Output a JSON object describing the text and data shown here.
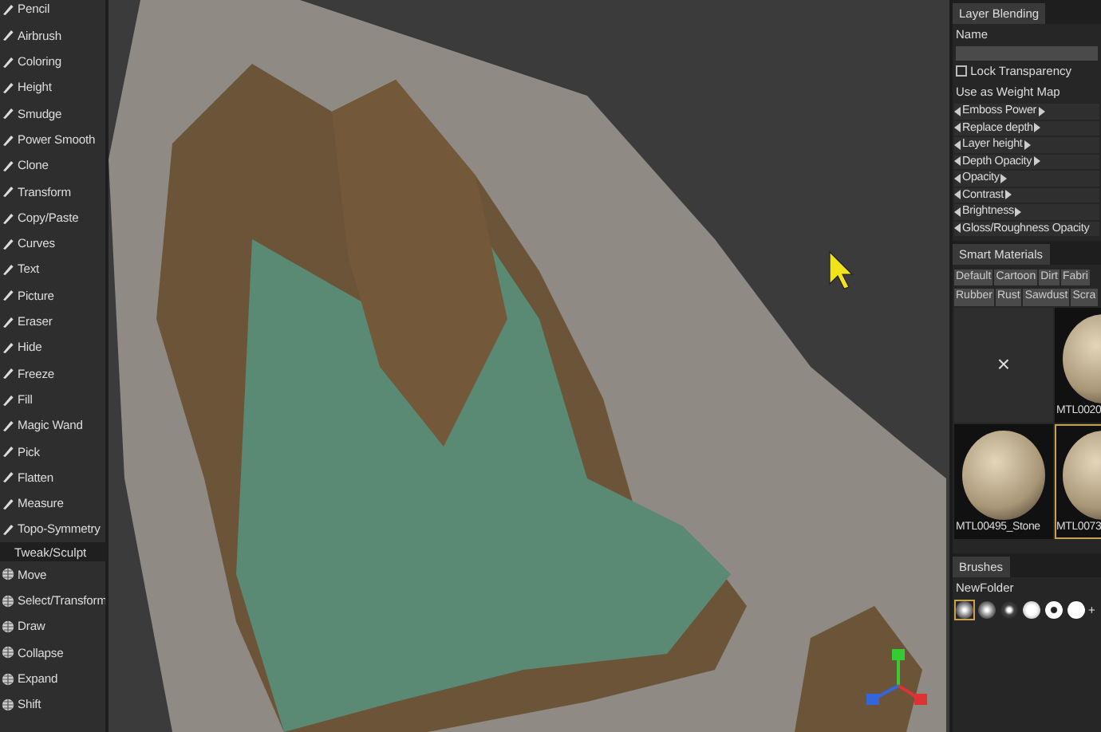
{
  "tools": [
    {
      "label": "Pencil",
      "kind": "tool"
    },
    {
      "label": "Airbrush",
      "kind": "tool"
    },
    {
      "label": "Coloring",
      "kind": "tool"
    },
    {
      "label": "Height",
      "kind": "tool"
    },
    {
      "label": "Smudge",
      "kind": "tool"
    },
    {
      "label": "Power Smooth",
      "kind": "tool"
    },
    {
      "label": "Clone",
      "kind": "tool"
    },
    {
      "label": "Transform",
      "kind": "tool"
    },
    {
      "label": "Copy/Paste",
      "kind": "tool"
    },
    {
      "label": "Curves",
      "kind": "tool"
    },
    {
      "label": "Text",
      "kind": "tool"
    },
    {
      "label": "Picture",
      "kind": "tool"
    },
    {
      "label": "Eraser",
      "kind": "tool"
    },
    {
      "label": "Hide",
      "kind": "tool"
    },
    {
      "label": "Freeze",
      "kind": "tool"
    },
    {
      "label": "Fill",
      "kind": "tool"
    },
    {
      "label": "Magic Wand",
      "kind": "tool"
    },
    {
      "label": "Pick",
      "kind": "tool"
    },
    {
      "label": "Flatten",
      "kind": "tool"
    },
    {
      "label": "Measure",
      "kind": "tool"
    },
    {
      "label": "Topo-Symmetry",
      "kind": "tool"
    },
    {
      "label": "Tweak/Sculpt",
      "kind": "header"
    },
    {
      "label": "Move",
      "kind": "sculpt"
    },
    {
      "label": "Select/Transform",
      "kind": "sculpt"
    },
    {
      "label": "Draw",
      "kind": "sculpt"
    },
    {
      "label": "Collapse",
      "kind": "sculpt"
    },
    {
      "label": "Expand",
      "kind": "sculpt"
    },
    {
      "label": "Shift",
      "kind": "sculpt"
    }
  ],
  "layer_panel": {
    "tab": "Layer Blending",
    "name_label": "Name",
    "lock_transparency": {
      "label": "Lock Transparency",
      "checked": false
    },
    "weight_map_label": "Use as Weight Map",
    "sliders": [
      "Emboss Power",
      "Replace depth",
      "Layer height",
      "Depth Opacity",
      "Opacity",
      "Contrast",
      "Brightness",
      "Gloss/Roughness Opacity"
    ]
  },
  "smart_materials": {
    "tab": "Smart Materials",
    "categories": [
      "Default",
      "Cartoon",
      "Dirt",
      "Fabri",
      "Rubber",
      "Rust",
      "Sawdust",
      "Scra"
    ],
    "items": [
      {
        "kind": "empty",
        "label": "×",
        "selected": false
      },
      {
        "kind": "material",
        "label": "MTL0020",
        "selected": false
      },
      {
        "kind": "material",
        "label": "MTL00495_Stone",
        "selected": false
      },
      {
        "kind": "material",
        "label": "MTL0073",
        "selected": true
      }
    ]
  },
  "brushes": {
    "tab": "Brushes",
    "folder": "NewFolder",
    "items": [
      {
        "kind": "soft",
        "selected": true
      },
      {
        "kind": "soft",
        "selected": false
      },
      {
        "kind": "dot",
        "selected": false
      },
      {
        "kind": "hard",
        "selected": false
      },
      {
        "kind": "ring",
        "selected": false
      },
      {
        "kind": "solid",
        "selected": false
      }
    ],
    "add_label": "+"
  }
}
